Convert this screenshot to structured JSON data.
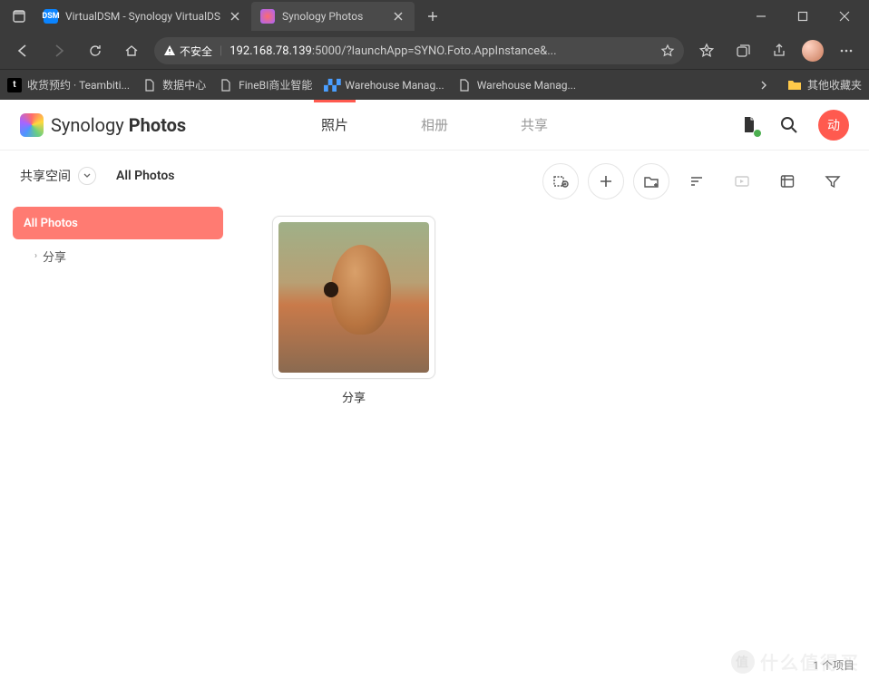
{
  "browser": {
    "tabs": [
      {
        "title": "VirtualDSM - Synology VirtualDS",
        "favicon": "DSM",
        "active": false
      },
      {
        "title": "Synology Photos",
        "favicon": "photos",
        "active": true
      }
    ],
    "address": {
      "insecure_label": "不安全",
      "host": "192.168.78.139",
      "path": ":5000/?launchApp=SYNO.Foto.AppInstance&..."
    },
    "bookmarks": [
      {
        "label": "收货预约 · Teambiti...",
        "icon": "t"
      },
      {
        "label": "数据中心",
        "icon": "page"
      },
      {
        "label": "FineBI商业智能",
        "icon": "page"
      },
      {
        "label": "Warehouse Manag...",
        "icon": "wms"
      },
      {
        "label": "Warehouse Manag...",
        "icon": "page"
      }
    ],
    "other_bookmarks": "其他收藏夹"
  },
  "app": {
    "logo": {
      "brand": "Synology",
      "product": "Photos"
    },
    "nav_tabs": [
      {
        "label": "照片",
        "active": true
      },
      {
        "label": "相册",
        "active": false
      },
      {
        "label": "共享",
        "active": false
      }
    ],
    "user_initial": "动",
    "sidebar": {
      "space": "共享空间",
      "breadcrumb": "All Photos",
      "tree": {
        "root": "All Photos",
        "children": [
          {
            "label": "分享"
          }
        ]
      }
    },
    "grid": {
      "items": [
        {
          "label": "分享"
        }
      ]
    },
    "status": "1 个项目"
  },
  "watermark": {
    "badge": "值",
    "text": "什么值得买"
  }
}
